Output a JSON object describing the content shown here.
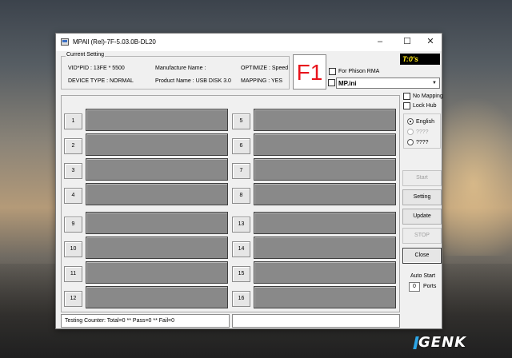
{
  "window": {
    "title": "MPAll (Rel)-7F-5.03.0B-DL20",
    "minimize": "–",
    "maximize": "☐",
    "close": "✕"
  },
  "current_setting": {
    "legend": "Current Setting",
    "vid_pid": "VID*PID : 13FE * 5500",
    "manufacture": "Manufacture Name :",
    "optimize": "OPTIMIZE : Speed",
    "device_type": "DEVICE TYPE : NORMAL",
    "product": "Product Name : USB DISK 3.0",
    "mapping": "MAPPING : YES"
  },
  "f1_label": "F1",
  "timer": "T:0's",
  "options": {
    "phison_rma": "For Phison RMA",
    "ini_file": "MP.ini",
    "no_mapping": "No Mapping",
    "lock_hub": "Lock Hub"
  },
  "language": {
    "options": [
      {
        "label": "English",
        "selected": true,
        "enabled": true
      },
      {
        "label": "????",
        "selected": false,
        "enabled": false
      },
      {
        "label": "????",
        "selected": false,
        "enabled": true
      }
    ]
  },
  "slots": {
    "left": [
      "1",
      "2",
      "3",
      "4",
      "9",
      "10",
      "11",
      "12"
    ],
    "right": [
      "5",
      "6",
      "7",
      "8",
      "13",
      "14",
      "15",
      "16"
    ]
  },
  "buttons": {
    "start": "Start",
    "setting": "Setting",
    "update": "Update",
    "stop": "STOP",
    "close": "Close"
  },
  "auto_start": {
    "label": "Auto Start",
    "ports_value": "0",
    "ports_label": "Ports"
  },
  "status": {
    "counter": "Testing Counter: Total=0 ** Pass=0 ** Fail=0",
    "right": ""
  },
  "watermark": "GENK",
  "colors": {
    "slot_panel": "#898989",
    "f1_red": "#e8141c",
    "timer_bg": "#000000",
    "timer_fg": "#ffe81a",
    "watermark_accent": "#2da6e6"
  }
}
